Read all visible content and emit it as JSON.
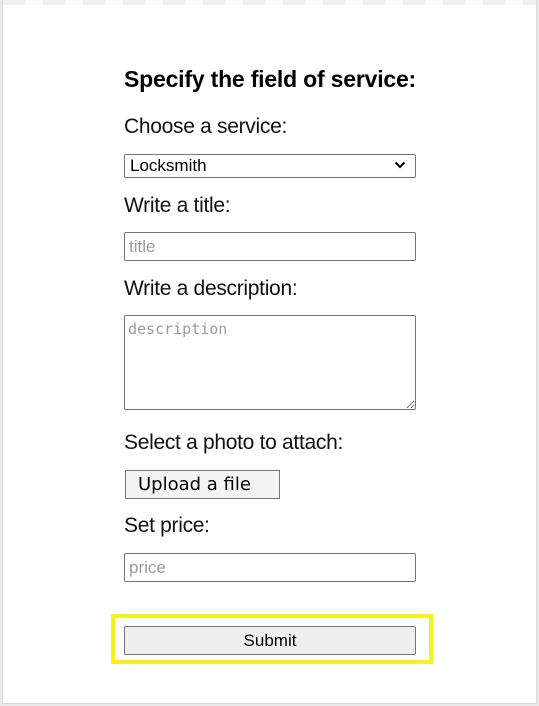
{
  "form": {
    "heading": "Specify the field of service:",
    "service": {
      "label": "Choose a service:",
      "selected": "Locksmith"
    },
    "title": {
      "label": "Write a title:",
      "placeholder": "title"
    },
    "description": {
      "label": "Write a description:",
      "placeholder": "description"
    },
    "photo": {
      "label": "Select a photo to attach:",
      "button_label": "Upload a file"
    },
    "price": {
      "label": "Set price:",
      "placeholder": "price"
    },
    "submit_label": "Submit"
  },
  "colors": {
    "highlight": "#f4f21d",
    "button_bg": "#efefef",
    "border": "#767676",
    "placeholder": "#9a9a9a"
  },
  "icons": {
    "select_arrow": "chevron-down-icon"
  }
}
